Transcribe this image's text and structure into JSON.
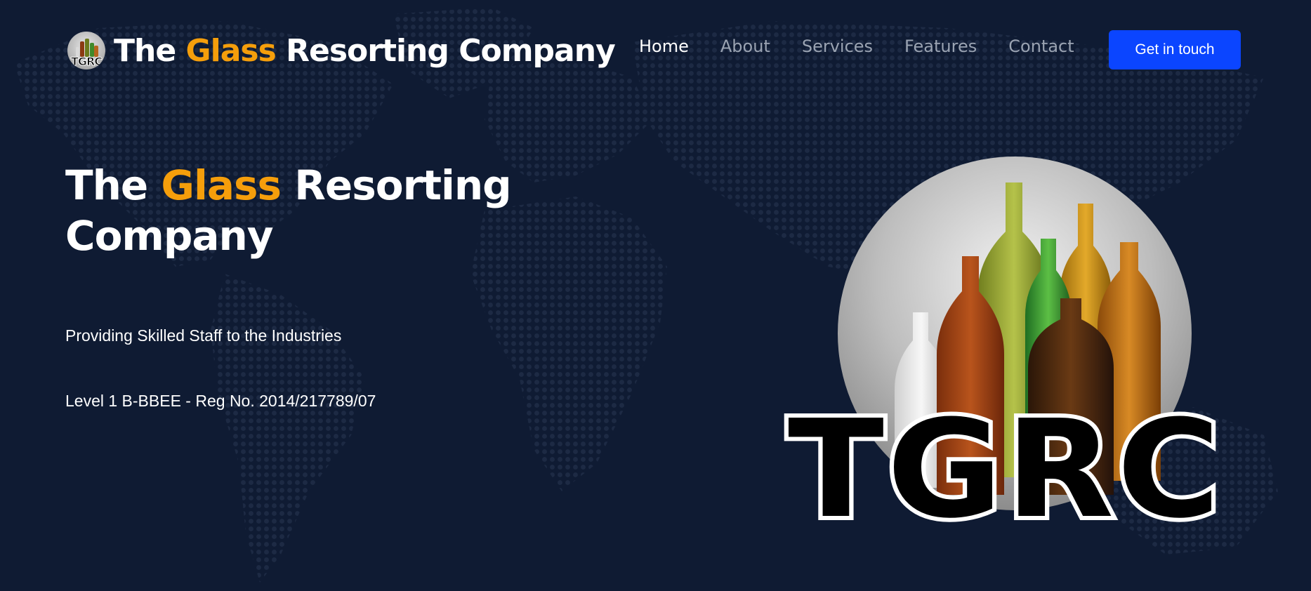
{
  "brand": {
    "logo_text": "TGRC",
    "title_parts": {
      "pre": "The ",
      "accent": "Glass",
      "post": " Resorting Company"
    }
  },
  "nav": {
    "items": [
      {
        "label": "Home",
        "active": true
      },
      {
        "label": "About",
        "active": false
      },
      {
        "label": "Services",
        "active": false
      },
      {
        "label": "Features",
        "active": false
      },
      {
        "label": "Contact",
        "active": false
      }
    ],
    "cta_label": "Get in touch"
  },
  "hero": {
    "title_pre": "The ",
    "title_accent": "Glass",
    "title_post": " Resorting Company",
    "subtitle": "Providing Skilled Staff to the Industries",
    "registration": "Level 1 B-BBEE - Reg No. 2014/217789/07",
    "image_logo_text": "TGRC"
  },
  "colors": {
    "background": "#0f1b33",
    "accent": "#f59e0b",
    "cta": "#0b45ff",
    "nav_inactive": "#9aa3b2"
  }
}
